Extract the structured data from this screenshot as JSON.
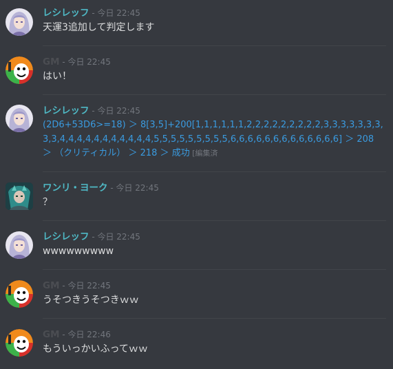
{
  "messages": [
    {
      "author": "レシレッフ",
      "timestamp": " - 今日 22:45",
      "text": "天運3追加して判定します"
    },
    {
      "author": "GM",
      "timestamp": " - 今日 22:45",
      "text": "はい！"
    },
    {
      "author": "レシレッフ",
      "timestamp": " - 今日 22:45",
      "text": "(2D6+53D6>=18) ＞ 8[3,5]+200[1,1,1,1,1,1,2,2,2,2,2,2,2,2,2,3,3,3,3,3,3,3,3,3,4,4,4,4,4,4,4,4,4,4,4,5,5,5,5,5,5,5,5,5,6,6,6,6,6,6,6,6,6,6,6,6,6] ＞ 208 ＞ （クリティカル） ＞ 218 ＞ 成功",
      "edited": " [編集済"
    },
    {
      "author": "ワンリ・ヨーク",
      "timestamp": " - 今日 22:45",
      "text": "？"
    },
    {
      "author": "レシレッフ",
      "timestamp": " - 今日 22:45",
      "text": "wwwwwwwww"
    },
    {
      "author": "GM",
      "timestamp": " - 今日 22:45",
      "text": "うそつきうそつきｗｗ"
    },
    {
      "author": "GM",
      "timestamp": " - 今日 22:46",
      "text": "もういっかいふってｗｗ"
    }
  ],
  "colors": {
    "background": "#36393f",
    "author_cyan": "#4fb9c5",
    "gm_name": "#4b4d52",
    "dice_blue": "#3a9be0",
    "timestamp": "#72767d"
  }
}
